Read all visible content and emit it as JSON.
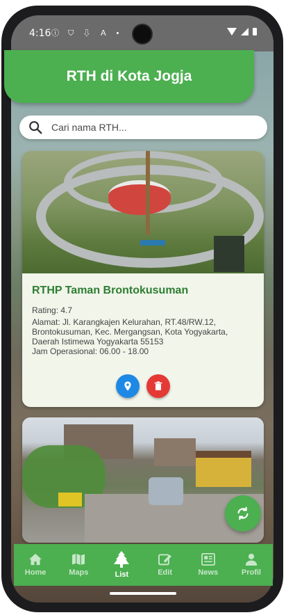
{
  "status_bar": {
    "time": "4:16",
    "left_icons": [
      "info-icon",
      "shield-icon",
      "download-icon",
      "a-icon",
      "dot-icon"
    ],
    "right_icons": [
      "wifi-icon",
      "signal-icon",
      "battery-icon"
    ]
  },
  "app_bar": {
    "title": "RTH di Kota Jogja"
  },
  "search": {
    "placeholder": "Cari nama RTH..."
  },
  "cards": [
    {
      "title": "RTHP Taman Brontokusuman",
      "rating": "Rating: 4.7",
      "address": "Alamat: Jl. Karangkajen Kelurahan, RT.48/RW.12, Brontokusuman, Kec. Mergangsan, Kota Yogyakarta, Daerah Istimewa Yogyakarta 55153",
      "hours": "Jam Operasional: 06.00 - 18.00",
      "actions": [
        "location-icon",
        "delete-icon"
      ]
    }
  ],
  "fab": {
    "icon": "refresh-icon"
  },
  "bottom_nav": {
    "items": [
      {
        "label": "Home",
        "icon": "home-icon"
      },
      {
        "label": "Maps",
        "icon": "map-icon"
      },
      {
        "label": "List",
        "icon": "tree-icon"
      },
      {
        "label": "Edit",
        "icon": "edit-icon"
      },
      {
        "label": "News",
        "icon": "news-icon"
      },
      {
        "label": "Profil",
        "icon": "person-icon"
      }
    ],
    "active": "List"
  },
  "colors": {
    "primary": "#4caf50",
    "card_title": "#2e7d32",
    "map_button": "#1e88e5",
    "delete_button": "#e53935",
    "card_background": "#f1f5ea"
  }
}
